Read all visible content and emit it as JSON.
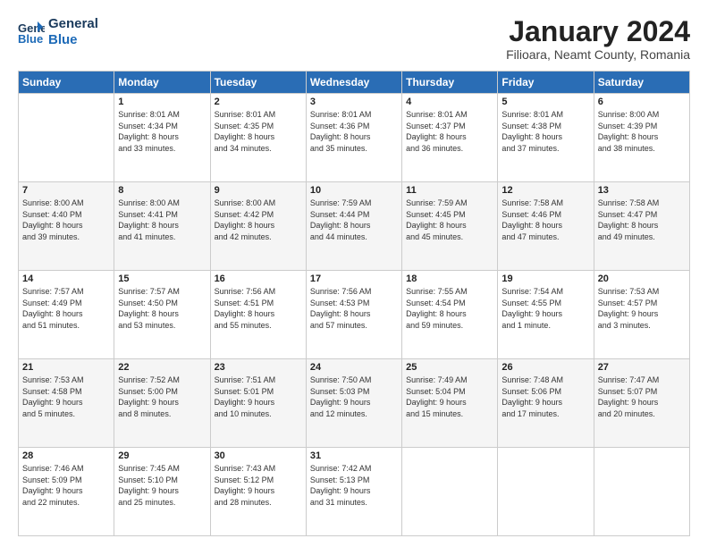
{
  "header": {
    "logo_line1": "General",
    "logo_line2": "Blue",
    "month": "January 2024",
    "location": "Filioara, Neamt County, Romania"
  },
  "weekdays": [
    "Sunday",
    "Monday",
    "Tuesday",
    "Wednesday",
    "Thursday",
    "Friday",
    "Saturday"
  ],
  "weeks": [
    [
      {
        "day": "",
        "info": ""
      },
      {
        "day": "1",
        "info": "Sunrise: 8:01 AM\nSunset: 4:34 PM\nDaylight: 8 hours\nand 33 minutes."
      },
      {
        "day": "2",
        "info": "Sunrise: 8:01 AM\nSunset: 4:35 PM\nDaylight: 8 hours\nand 34 minutes."
      },
      {
        "day": "3",
        "info": "Sunrise: 8:01 AM\nSunset: 4:36 PM\nDaylight: 8 hours\nand 35 minutes."
      },
      {
        "day": "4",
        "info": "Sunrise: 8:01 AM\nSunset: 4:37 PM\nDaylight: 8 hours\nand 36 minutes."
      },
      {
        "day": "5",
        "info": "Sunrise: 8:01 AM\nSunset: 4:38 PM\nDaylight: 8 hours\nand 37 minutes."
      },
      {
        "day": "6",
        "info": "Sunrise: 8:00 AM\nSunset: 4:39 PM\nDaylight: 8 hours\nand 38 minutes."
      }
    ],
    [
      {
        "day": "7",
        "info": "Sunrise: 8:00 AM\nSunset: 4:40 PM\nDaylight: 8 hours\nand 39 minutes."
      },
      {
        "day": "8",
        "info": "Sunrise: 8:00 AM\nSunset: 4:41 PM\nDaylight: 8 hours\nand 41 minutes."
      },
      {
        "day": "9",
        "info": "Sunrise: 8:00 AM\nSunset: 4:42 PM\nDaylight: 8 hours\nand 42 minutes."
      },
      {
        "day": "10",
        "info": "Sunrise: 7:59 AM\nSunset: 4:44 PM\nDaylight: 8 hours\nand 44 minutes."
      },
      {
        "day": "11",
        "info": "Sunrise: 7:59 AM\nSunset: 4:45 PM\nDaylight: 8 hours\nand 45 minutes."
      },
      {
        "day": "12",
        "info": "Sunrise: 7:58 AM\nSunset: 4:46 PM\nDaylight: 8 hours\nand 47 minutes."
      },
      {
        "day": "13",
        "info": "Sunrise: 7:58 AM\nSunset: 4:47 PM\nDaylight: 8 hours\nand 49 minutes."
      }
    ],
    [
      {
        "day": "14",
        "info": "Sunrise: 7:57 AM\nSunset: 4:49 PM\nDaylight: 8 hours\nand 51 minutes."
      },
      {
        "day": "15",
        "info": "Sunrise: 7:57 AM\nSunset: 4:50 PM\nDaylight: 8 hours\nand 53 minutes."
      },
      {
        "day": "16",
        "info": "Sunrise: 7:56 AM\nSunset: 4:51 PM\nDaylight: 8 hours\nand 55 minutes."
      },
      {
        "day": "17",
        "info": "Sunrise: 7:56 AM\nSunset: 4:53 PM\nDaylight: 8 hours\nand 57 minutes."
      },
      {
        "day": "18",
        "info": "Sunrise: 7:55 AM\nSunset: 4:54 PM\nDaylight: 8 hours\nand 59 minutes."
      },
      {
        "day": "19",
        "info": "Sunrise: 7:54 AM\nSunset: 4:55 PM\nDaylight: 9 hours\nand 1 minute."
      },
      {
        "day": "20",
        "info": "Sunrise: 7:53 AM\nSunset: 4:57 PM\nDaylight: 9 hours\nand 3 minutes."
      }
    ],
    [
      {
        "day": "21",
        "info": "Sunrise: 7:53 AM\nSunset: 4:58 PM\nDaylight: 9 hours\nand 5 minutes."
      },
      {
        "day": "22",
        "info": "Sunrise: 7:52 AM\nSunset: 5:00 PM\nDaylight: 9 hours\nand 8 minutes."
      },
      {
        "day": "23",
        "info": "Sunrise: 7:51 AM\nSunset: 5:01 PM\nDaylight: 9 hours\nand 10 minutes."
      },
      {
        "day": "24",
        "info": "Sunrise: 7:50 AM\nSunset: 5:03 PM\nDaylight: 9 hours\nand 12 minutes."
      },
      {
        "day": "25",
        "info": "Sunrise: 7:49 AM\nSunset: 5:04 PM\nDaylight: 9 hours\nand 15 minutes."
      },
      {
        "day": "26",
        "info": "Sunrise: 7:48 AM\nSunset: 5:06 PM\nDaylight: 9 hours\nand 17 minutes."
      },
      {
        "day": "27",
        "info": "Sunrise: 7:47 AM\nSunset: 5:07 PM\nDaylight: 9 hours\nand 20 minutes."
      }
    ],
    [
      {
        "day": "28",
        "info": "Sunrise: 7:46 AM\nSunset: 5:09 PM\nDaylight: 9 hours\nand 22 minutes."
      },
      {
        "day": "29",
        "info": "Sunrise: 7:45 AM\nSunset: 5:10 PM\nDaylight: 9 hours\nand 25 minutes."
      },
      {
        "day": "30",
        "info": "Sunrise: 7:43 AM\nSunset: 5:12 PM\nDaylight: 9 hours\nand 28 minutes."
      },
      {
        "day": "31",
        "info": "Sunrise: 7:42 AM\nSunset: 5:13 PM\nDaylight: 9 hours\nand 31 minutes."
      },
      {
        "day": "",
        "info": ""
      },
      {
        "day": "",
        "info": ""
      },
      {
        "day": "",
        "info": ""
      }
    ]
  ]
}
